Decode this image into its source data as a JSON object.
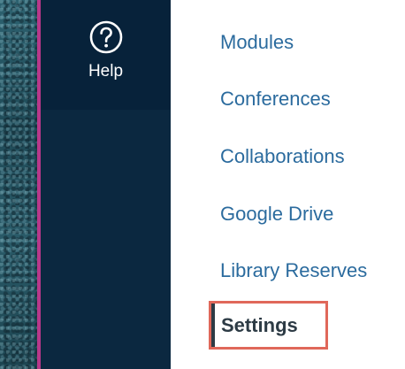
{
  "global_nav": {
    "help_label": "Help",
    "help_icon": "help-question-icon"
  },
  "course_nav": {
    "items": [
      {
        "label": "Modules"
      },
      {
        "label": "Conferences"
      },
      {
        "label": "Collaborations"
      },
      {
        "label": "Google Drive"
      },
      {
        "label": "Library Reserves"
      }
    ],
    "active_item": {
      "label": "Settings",
      "highlighted": true
    }
  },
  "colors": {
    "nav_background": "#0b2840",
    "accent_line": "#b8388a",
    "link": "#2b6b9e",
    "active_text": "#2d3b45",
    "highlight_border": "#e0685a"
  }
}
